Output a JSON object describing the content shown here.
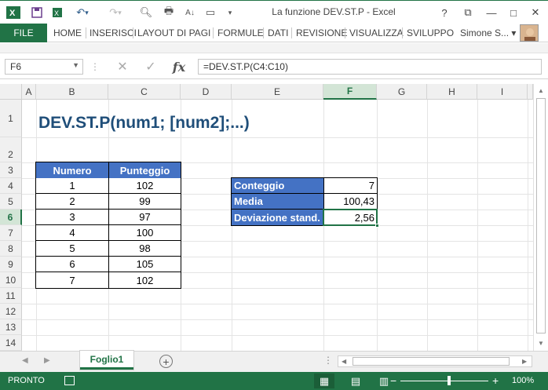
{
  "window": {
    "title": "La funzione DEV.ST.P - Excel",
    "help": "?",
    "restore": "⧉",
    "minimize": "—",
    "maximize": "□",
    "close": "✕"
  },
  "ribbon": {
    "file": "FILE",
    "tabs": [
      "HOME",
      "INSERISCI",
      "LAYOUT DI PAGI",
      "FORMULE",
      "DATI",
      "REVISIONE",
      "VISUALIZZA",
      "SVILUPPO"
    ],
    "user": "Simone S... ▾"
  },
  "formula_bar": {
    "name_box": "F6",
    "formula": "=DEV.ST.P(C4:C10)"
  },
  "columns": [
    "A",
    "B",
    "C",
    "D",
    "E",
    "F",
    "G",
    "H",
    "I"
  ],
  "rows": [
    "1",
    "2",
    "3",
    "4",
    "5",
    "6",
    "7",
    "8",
    "9",
    "10",
    "11",
    "12",
    "13",
    "14"
  ],
  "sheet": {
    "title": "DEV.ST.P(num1; [num2];...)",
    "table": {
      "headers": [
        "Numero",
        "Punteggio"
      ],
      "rows": [
        [
          "1",
          "102"
        ],
        [
          "2",
          "99"
        ],
        [
          "3",
          "97"
        ],
        [
          "4",
          "100"
        ],
        [
          "5",
          "98"
        ],
        [
          "6",
          "105"
        ],
        [
          "7",
          "102"
        ]
      ]
    },
    "stats": [
      {
        "label": "Conteggio",
        "value": "7"
      },
      {
        "label": "Media",
        "value": "100,43"
      },
      {
        "label": "Deviazione stand.",
        "value": "2,56"
      }
    ]
  },
  "sheet_tabs": {
    "active": "Foglio1",
    "add": "+"
  },
  "status": {
    "ready": "PRONTO",
    "zoom_minus": "−",
    "zoom_plus": "+",
    "zoom": "100%"
  },
  "colors": {
    "excel_green": "#217346",
    "table_blue": "#4472c4",
    "title_blue": "#1f4e79"
  }
}
